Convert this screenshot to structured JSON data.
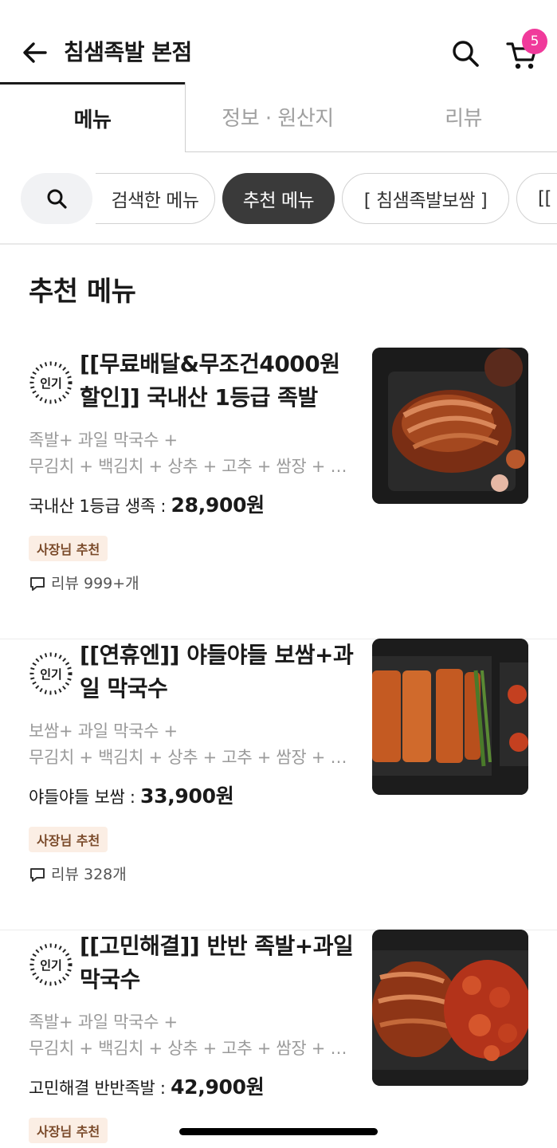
{
  "header": {
    "back_icon": "arrow-left-icon",
    "title": "침샘족발 본점",
    "search_icon": "search-icon",
    "cart_icon": "cart-icon",
    "cart_count": "5",
    "badge_color": "#f03a9b"
  },
  "tabs": [
    {
      "label": "메뉴",
      "active": true
    },
    {
      "label": "정보 · 원산지",
      "active": false
    },
    {
      "label": "리뷰",
      "active": false
    }
  ],
  "chips": [
    {
      "label": "검색한 메뉴",
      "active": false
    },
    {
      "label": "추천 메뉴",
      "active": true
    },
    {
      "label": "[ 침샘족발보쌈 ]",
      "active": false
    },
    {
      "label": "[[",
      "active": false
    }
  ],
  "section": {
    "title": "추천 메뉴"
  },
  "items": [
    {
      "badge": "인기",
      "name": "[[무료배달&무조건4000원할인]] 국내산 1등급 족발",
      "desc_line1": "족발+ 과일 막국수 +",
      "desc_line2": "무김치 + 백김치 + 상추 + 고추 + 쌈장 + 새우젓",
      "price_label": "국내산 1등급 생족 :",
      "price": "28,900원",
      "owner_badge": "사장님 추천",
      "review": "리뷰 999+개"
    },
    {
      "badge": "인기",
      "name": "[[연휴엔]] 야들야들 보쌈+과일 막국수",
      "desc_line1": "보쌈+ 과일 막국수 +",
      "desc_line2": "무김치 + 백김치 + 상추 + 고추 + 쌈장 + 새우젓",
      "price_label": "야들야들 보쌈 :",
      "price": "33,900원",
      "owner_badge": "사장님 추천",
      "review": "리뷰 328개"
    },
    {
      "badge": "인기",
      "name": "[[고민해결]] 반반 족발+과일 막국수",
      "desc_line1": "족발+ 과일 막국수 +",
      "desc_line2": "무김치 + 백김치 + 상추 + 고추 + 쌈장 + 새우젓",
      "price_label": "고민해결 반반족발 :",
      "price": "42,900원",
      "owner_badge": "사장님 추천",
      "review": ""
    }
  ]
}
